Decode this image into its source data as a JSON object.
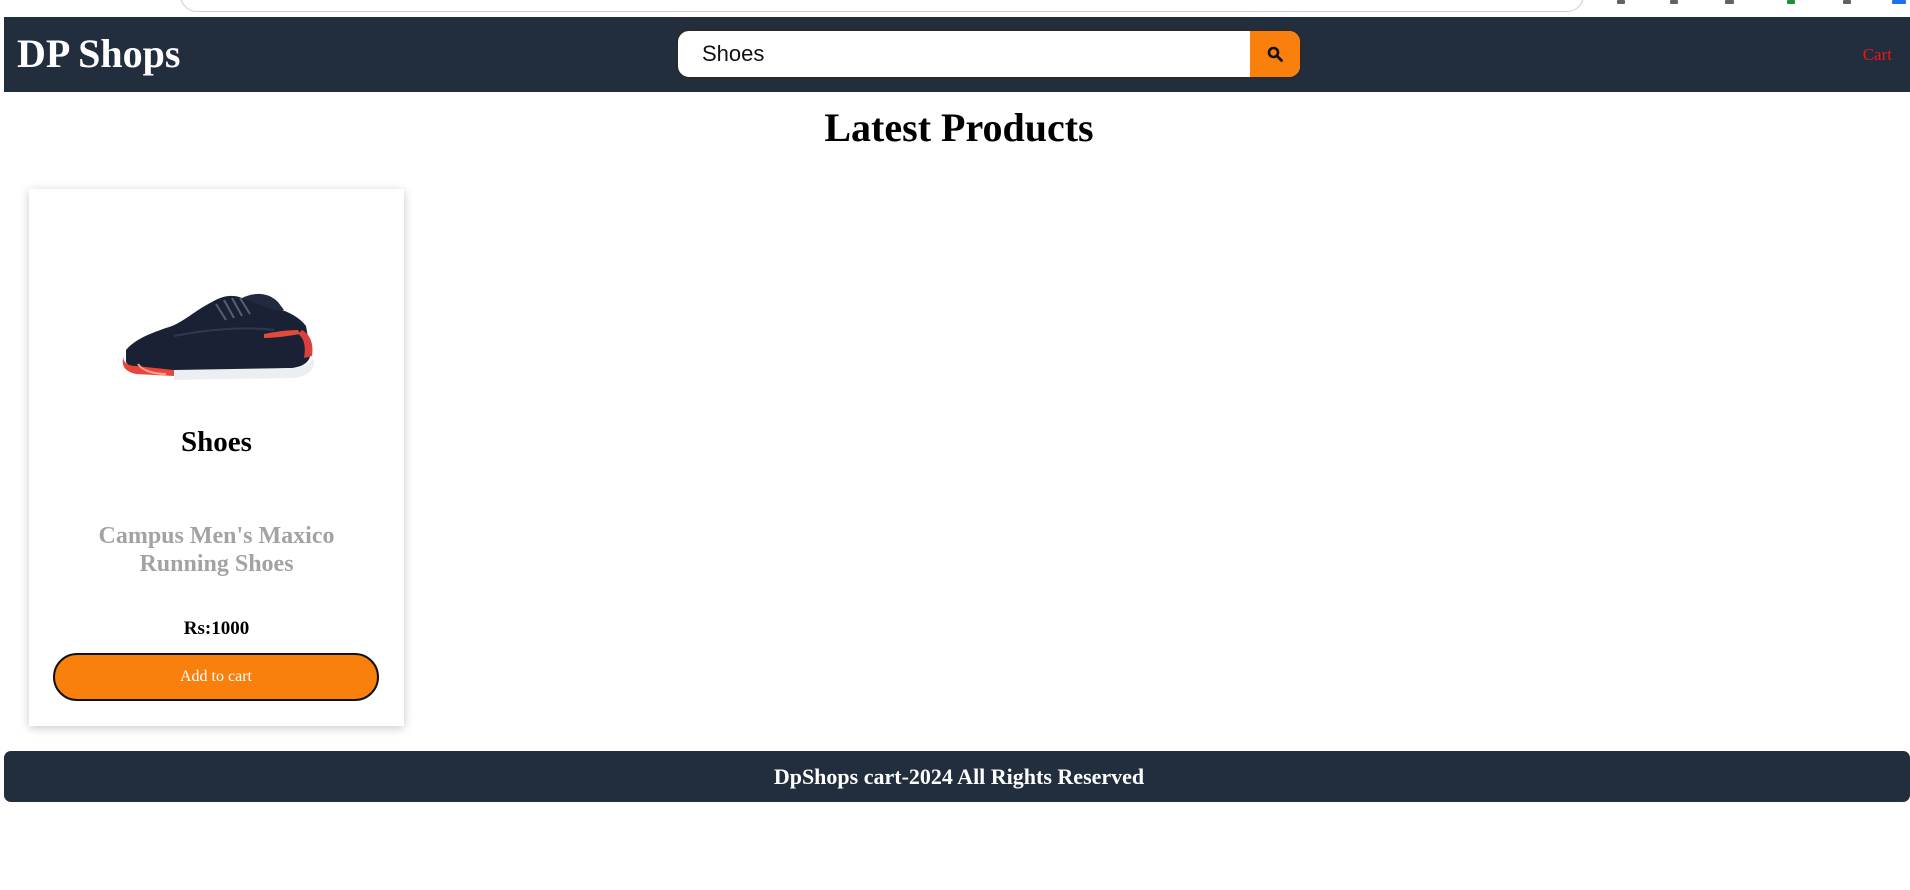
{
  "header": {
    "brand": "DP Shops",
    "search": {
      "value": "Shoes",
      "icon": "search-icon"
    },
    "cart_label": "Cart"
  },
  "main": {
    "heading": "Latest Products",
    "products": [
      {
        "name": "Shoes",
        "description": "Campus Men's Maxico Running Shoes",
        "price": "Rs:1000",
        "button_label": "Add to cart",
        "image": "running-shoe-image"
      }
    ]
  },
  "footer": {
    "text": "DpShops cart-2024 All Rights Reserved"
  },
  "colors": {
    "navbar": "#222d3e",
    "accent": "#f9800c",
    "cart_link": "#f01515",
    "description": "#a3a3a3"
  }
}
